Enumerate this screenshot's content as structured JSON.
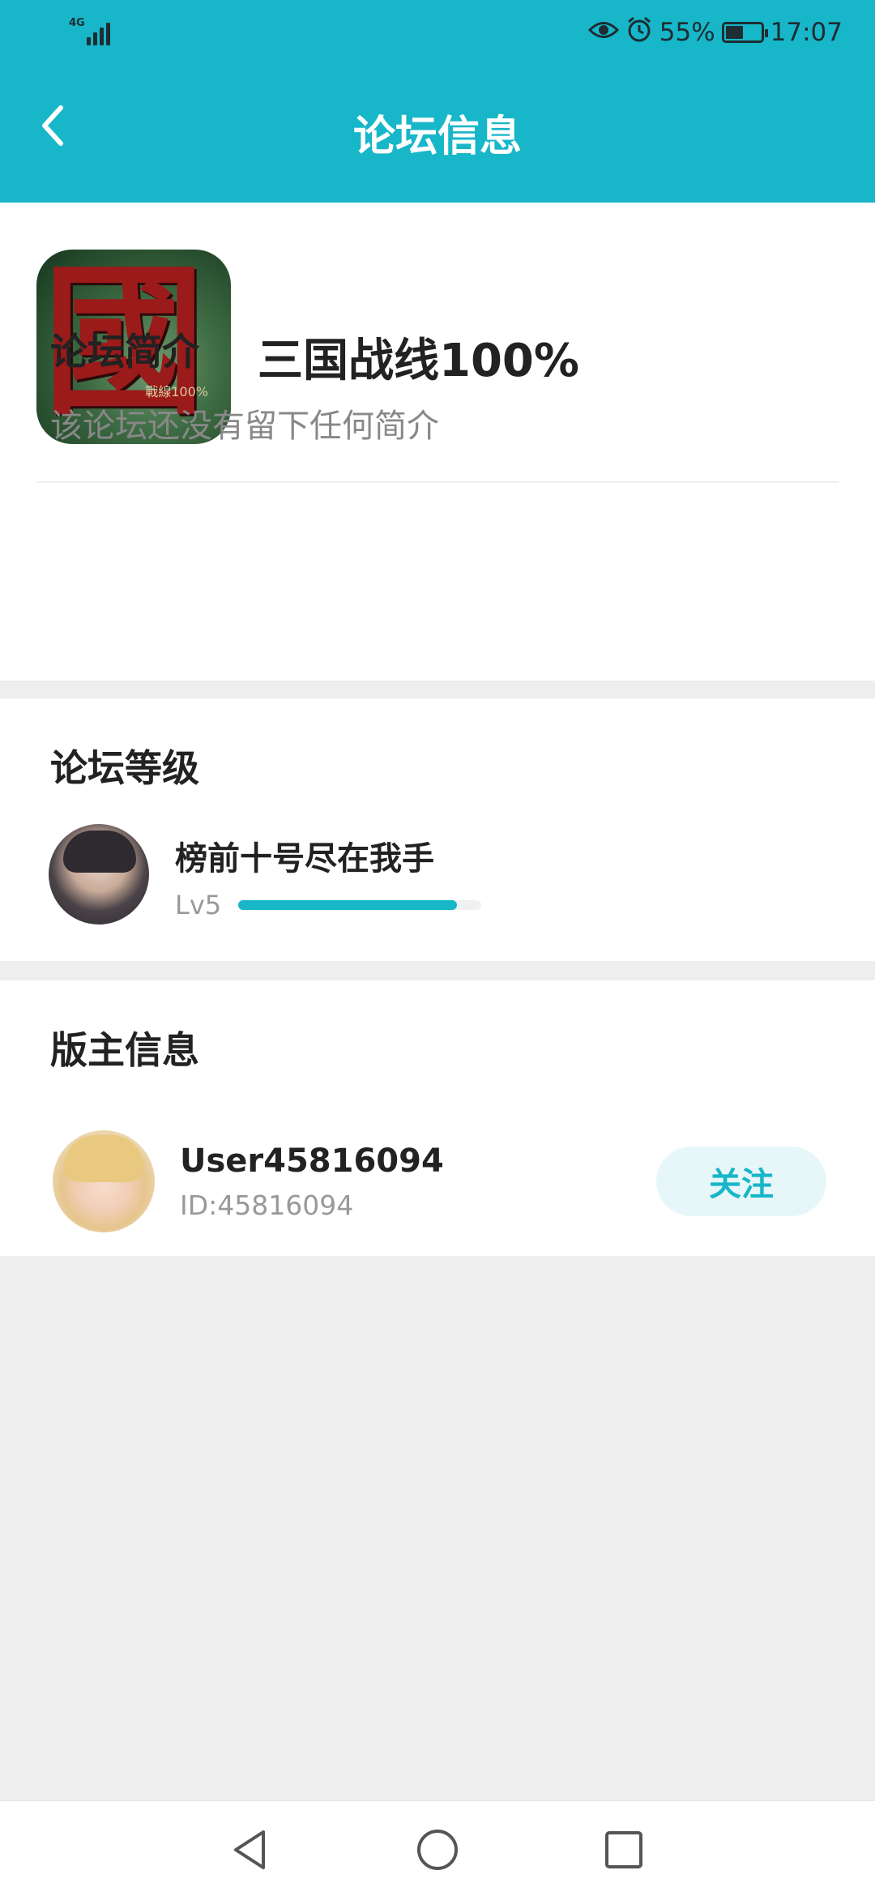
{
  "status_bar": {
    "network": "4G",
    "battery_percent": "55%",
    "battery_level": 0.55,
    "time": "17:07",
    "icons": [
      "eye-icon",
      "alarm-icon",
      "battery-icon",
      "signal-icon"
    ]
  },
  "header": {
    "title": "论坛信息",
    "back_icon": "chevron-left-icon"
  },
  "forum": {
    "name": "三国战线100%",
    "icon_char": "國",
    "icon_sub": "戰線100%"
  },
  "intro": {
    "title": "论坛简介",
    "text": "该论坛还没有留下任何简介"
  },
  "level": {
    "title": "论坛等级",
    "user_name": "榜前十号尽在我手",
    "level_label": "Lv5",
    "progress": 0.9
  },
  "moderator": {
    "title": "版主信息",
    "name": "User45816094",
    "id_text": "ID:45816094",
    "follow_label": "关注"
  },
  "colors": {
    "accent": "#17b6c8",
    "page_bg": "#eeeeee"
  },
  "system_nav": [
    "back-triangle-icon",
    "home-circle-icon",
    "recents-square-icon"
  ]
}
